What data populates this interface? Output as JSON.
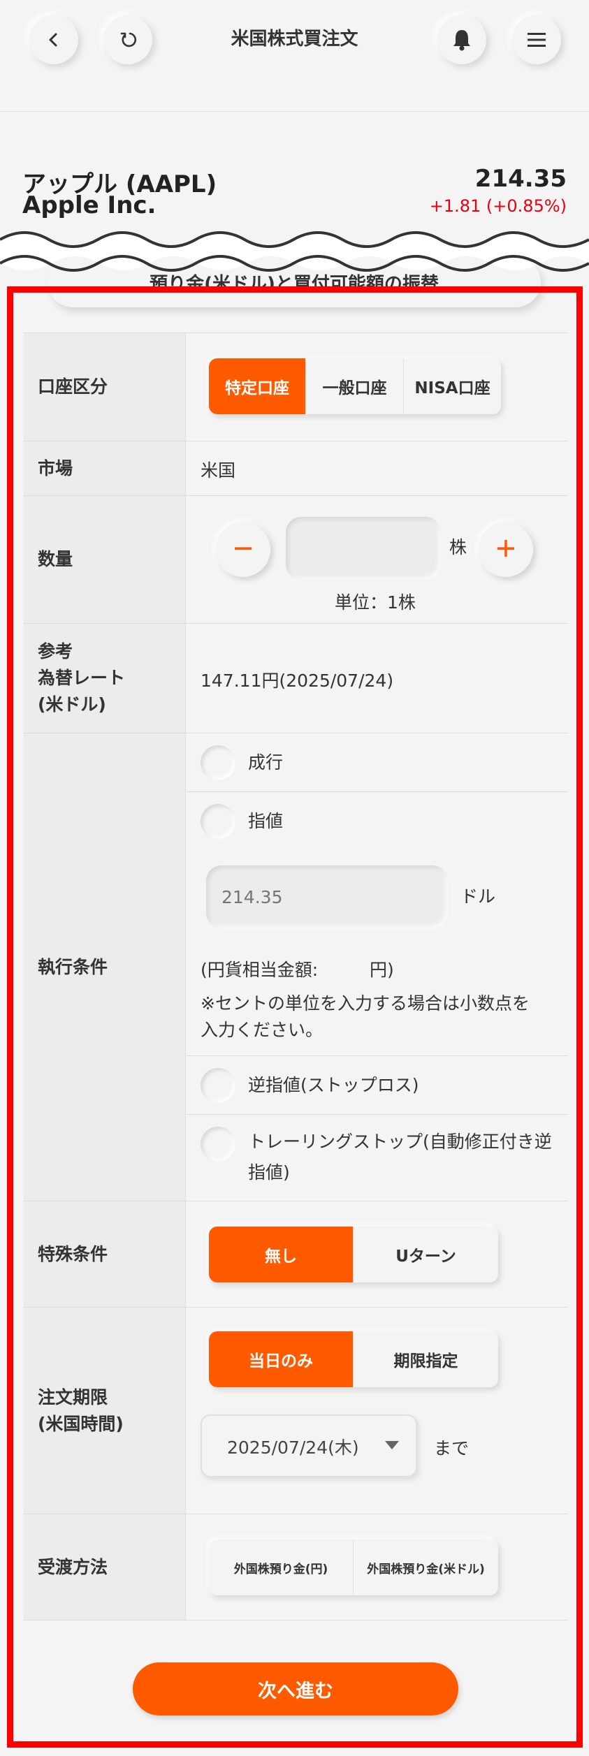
{
  "header": {
    "title": "米国株式買注文",
    "back_icon": "chevron-left",
    "refresh_icon": "refresh",
    "bell_icon": "bell",
    "menu_icon": "hamburger"
  },
  "stock": {
    "name_ja": "アップル (AAPL)",
    "name_en": "Apple Inc.",
    "price": "214.35",
    "change": "+1.81",
    "change_pct": "(+0.85%)",
    "change_color": "#e60012"
  },
  "fx_button_label": "預り金(米ドル)と買付可能額の振替",
  "form": {
    "account_type": {
      "label": "口座区分",
      "options": [
        "特定口座",
        "一般口座",
        "NISA口座"
      ],
      "selected": "特定口座"
    },
    "market": {
      "label": "市場",
      "value": "米国"
    },
    "quantity": {
      "label": "数量",
      "value": "",
      "unit": "株",
      "unit_note": "単位：1株",
      "minus": "−",
      "plus": "+"
    },
    "fx_rate": {
      "label_line1": "参考",
      "label_line2": "為替レート",
      "label_line3": "(米ドル)",
      "value": "147.11円(2025/07/24)"
    },
    "execution": {
      "label": "執行条件",
      "market_order": "成行",
      "limit_order": "指値",
      "limit_price_placeholder": "214.35",
      "limit_price_unit": "ドル",
      "yen_equivalent_label": "(円貨相当金額:",
      "yen_equivalent_unit": "円)",
      "cent_note_line1": "※セントの単位を入力する場合は小数点を",
      "cent_note_line2": "入力ください。",
      "stop_order": "逆指値(ストップロス)",
      "trailing_line1": "トレーリングストップ(自動修正付き逆",
      "trailing_line2": "指値)"
    },
    "special": {
      "label": "特殊条件",
      "options": [
        "無し",
        "Uターン"
      ],
      "selected": "無し"
    },
    "period": {
      "label_line1": "注文期限",
      "label_line2": "(米国時間)",
      "options": [
        "当日のみ",
        "期限指定"
      ],
      "selected": "当日のみ",
      "date": "2025/07/24(木)",
      "until": "まで"
    },
    "settlement": {
      "label": "受渡方法",
      "options": [
        "外国株預り金(円)",
        "外国株預り金(米ドル)"
      ]
    }
  },
  "next_button": "次へ進む",
  "colors": {
    "accent": "#ff5a00",
    "highlight_frame": "#ff0000",
    "background": "#f4f4f4"
  }
}
